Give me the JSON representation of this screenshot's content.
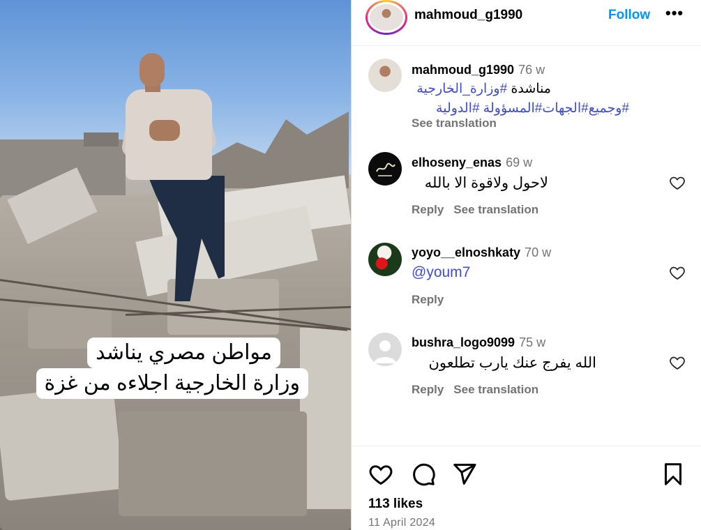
{
  "post": {
    "username": "mahmoud_g1990",
    "follow_label": "Follow",
    "more_label": "•••",
    "video_caption_line1": "مواطن مصري يناشد",
    "video_caption_line2": "وزارة الخارجية اجلاءه من غزة"
  },
  "caption": {
    "username": "mahmoud_g1990",
    "time": "76 w",
    "line1_text": "مناشدة",
    "line1_tag": "#وزارة_الخارجية",
    "line2_tags": "#وجميع#الجهات#المسؤولة  #الدولية",
    "see_translation": "See translation"
  },
  "comments": [
    {
      "username": "elhoseny_enas",
      "time": "69 w",
      "text": "لاحول ولاقوة الا بالله",
      "reply_label": "Reply",
      "translate_label": "See translation",
      "avatar_icon": "calligraphy-avatar"
    },
    {
      "username": "yoyo__elnoshkaty",
      "time": "70 w",
      "text": "@youm7",
      "reply_label": "Reply",
      "avatar_icon": "rose-avatar"
    },
    {
      "username": "bushra_logo9099",
      "time": "75 w",
      "text": "الله يفرج عنك يارب تطلعون",
      "reply_label": "Reply",
      "translate_label": "See translation",
      "avatar_icon": "default-avatar"
    }
  ],
  "actions": {
    "like_icon": "heart-icon",
    "comment_icon": "comment-icon",
    "share_icon": "share-icon",
    "save_icon": "bookmark-icon",
    "likes": "113 likes",
    "date": "11 April 2024"
  },
  "colors": {
    "accent": "#0095f6",
    "hashtag": "#3e4bd7",
    "muted": "#737373"
  }
}
